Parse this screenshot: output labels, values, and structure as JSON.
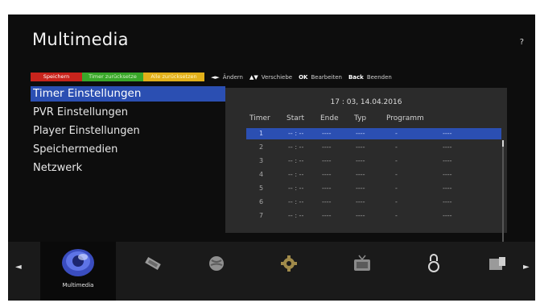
{
  "header": {
    "title": "Multimedia",
    "help": "?"
  },
  "keybar": {
    "red": "Speichern",
    "green": "Timer zurücksetze",
    "yellow": "Alle zurücksetzen",
    "lr_key": "◄►",
    "lr_label": "Ändern",
    "ud_key": "▲▼",
    "ud_label": "Verschiebe",
    "ok_key": "OK",
    "ok_label": "Bearbeiten",
    "back_key": "Back",
    "back_label": "Beenden"
  },
  "menu": {
    "items": [
      {
        "label": "Timer Einstellungen"
      },
      {
        "label": "PVR Einstellungen"
      },
      {
        "label": "Player Einstellungen"
      },
      {
        "label": "Speichermedien"
      },
      {
        "label": "Netzwerk"
      }
    ],
    "selected_index": 0
  },
  "timer_table": {
    "datetime": "17 : 03, 14.04.2016",
    "headers": {
      "timer": "Timer",
      "start": "Start",
      "ende": "Ende",
      "typ": "Typ",
      "programm": "Programm"
    },
    "rows": [
      {
        "timer": "1",
        "start": "-- : --",
        "ende": "----",
        "typ": "----",
        "prog": "-",
        "extra": "----"
      },
      {
        "timer": "2",
        "start": "-- : --",
        "ende": "----",
        "typ": "----",
        "prog": "-",
        "extra": "----"
      },
      {
        "timer": "3",
        "start": "-- : --",
        "ende": "----",
        "typ": "----",
        "prog": "-",
        "extra": "----"
      },
      {
        "timer": "4",
        "start": "-- : --",
        "ende": "----",
        "typ": "----",
        "prog": "-",
        "extra": "----"
      },
      {
        "timer": "5",
        "start": "-- : --",
        "ende": "----",
        "typ": "----",
        "prog": "-",
        "extra": "----"
      },
      {
        "timer": "6",
        "start": "-- : --",
        "ende": "----",
        "typ": "----",
        "prog": "-",
        "extra": "----"
      },
      {
        "timer": "7",
        "start": "-- : --",
        "ende": "----",
        "typ": "----",
        "prog": "-",
        "extra": "----"
      }
    ],
    "selected_row": 0
  },
  "bottom_nav": {
    "selected_label": "Multimedia",
    "icons": [
      "multimedia-icon",
      "ticket-icon",
      "globe-icon",
      "gear-icon",
      "tv-icon",
      "lock-icon",
      "card-reader-icon"
    ]
  },
  "colors": {
    "red": "#c8241c",
    "green": "#39a82a",
    "yellow": "#e2b01a",
    "highlight": "#2b4fb2"
  }
}
